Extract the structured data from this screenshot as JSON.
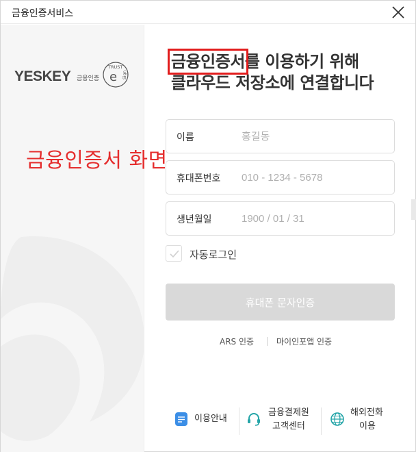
{
  "window": {
    "title": "금융인증서비스"
  },
  "brand": {
    "logo_text": "YESKEY",
    "logo_sub": "금융인증",
    "badge_text_top": "TRUST",
    "badge_text_side": "Sign"
  },
  "overlay_label": "금융인증서 화면",
  "heading": {
    "highlight": "금융인증서",
    "line1_rest": "를 이용하기 위해",
    "line2": "클라우드 저장소에 연결합니다"
  },
  "form": {
    "name": {
      "label": "이름",
      "placeholder": "홍길동"
    },
    "phone": {
      "label": "휴대폰번호",
      "placeholder": "010 - 1234 - 5678"
    },
    "birth": {
      "label": "생년월일",
      "placeholder": "1900 / 01 / 31"
    },
    "auto_login": {
      "label": "자동로그인",
      "checked": false
    },
    "submit_label": "휴대폰 문자인증"
  },
  "alt_auth": {
    "ars": "ARS 인증",
    "mydata": "마이인포앱 인증"
  },
  "footer": {
    "guide": "이용안내",
    "center_line1": "금융결제원",
    "center_line2": "고객센터",
    "overseas_line1": "해외전화",
    "overseas_line2": "이용"
  },
  "colors": {
    "highlight_box": "#e21d1d",
    "overlay_text": "#e52e2e",
    "button_disabled": "#d9d9d9",
    "guide_icon": "#3b8ee6",
    "headset_icon": "#25a5a8",
    "globe_icon": "#25a5a8"
  },
  "icons": {
    "close": "close-icon",
    "guide": "document-icon",
    "center": "headset-icon",
    "overseas": "globe-icon",
    "checkbox": "check-icon"
  }
}
